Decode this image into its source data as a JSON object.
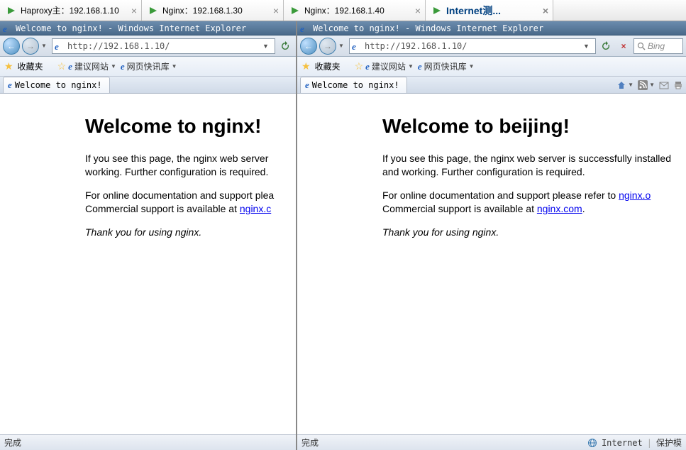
{
  "tabs": [
    {
      "label": "Haproxy主：192.168.1.10"
    },
    {
      "label": "Nginx：192.168.1.30"
    },
    {
      "label": "Nginx：192.168.1.40"
    },
    {
      "label": "Internet测..."
    }
  ],
  "left": {
    "title": "Welcome to nginx! - Windows Internet Explorer",
    "url": "http://192.168.1.10/",
    "fav_label": "收藏夹",
    "fav_link1": "建议网站",
    "fav_link2": "网页快讯库",
    "subtab": "Welcome to nginx!",
    "h1": "Welcome to nginx!",
    "p1a": "If you see this page, the nginx web server",
    "p1b": "working. Further configuration is required.",
    "p2a": "For online documentation and support plea",
    "p2b": "Commercial support is available at ",
    "link": "nginx.c",
    "thanks": "Thank you for using nginx.",
    "status": "完成"
  },
  "right": {
    "title": "Welcome to nginx! - Windows Internet Explorer",
    "url": "http://192.168.1.10/",
    "fav_label": "收藏夹",
    "fav_link1": "建议网站",
    "fav_link2": "网页快讯库",
    "subtab": "Welcome to nginx!",
    "search_placeholder": "Bing",
    "h1": "Welcome to beijing!",
    "p1": "If you see this page, the nginx web server is successfully installed and working. Further configuration is required.",
    "p2a": "For online documentation and support please refer to ",
    "link1": "nginx.o",
    "p2b": "Commercial support is available at ",
    "link2": "nginx.com",
    "p2c": ".",
    "thanks": "Thank you for using nginx.",
    "status": "完成",
    "status_r1": "Internet",
    "status_r2": "保护模"
  }
}
